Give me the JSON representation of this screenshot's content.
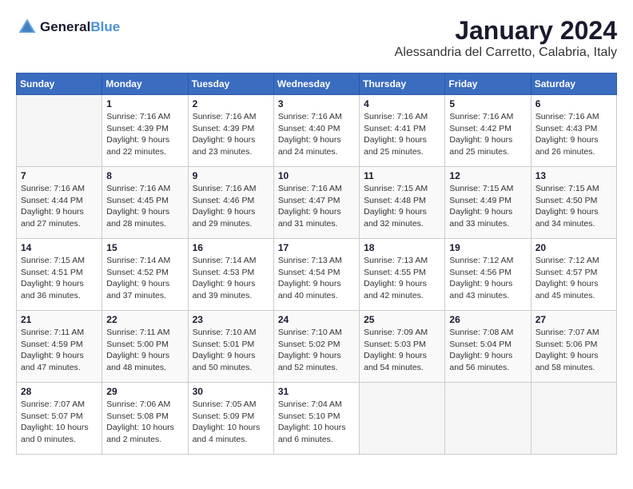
{
  "header": {
    "logo_line1": "General",
    "logo_line2": "Blue",
    "month": "January 2024",
    "location": "Alessandria del Carretto, Calabria, Italy"
  },
  "days_of_week": [
    "Sunday",
    "Monday",
    "Tuesday",
    "Wednesday",
    "Thursday",
    "Friday",
    "Saturday"
  ],
  "weeks": [
    [
      {
        "day": "",
        "info": ""
      },
      {
        "day": "1",
        "info": "Sunrise: 7:16 AM\nSunset: 4:39 PM\nDaylight: 9 hours\nand 22 minutes."
      },
      {
        "day": "2",
        "info": "Sunrise: 7:16 AM\nSunset: 4:39 PM\nDaylight: 9 hours\nand 23 minutes."
      },
      {
        "day": "3",
        "info": "Sunrise: 7:16 AM\nSunset: 4:40 PM\nDaylight: 9 hours\nand 24 minutes."
      },
      {
        "day": "4",
        "info": "Sunrise: 7:16 AM\nSunset: 4:41 PM\nDaylight: 9 hours\nand 25 minutes."
      },
      {
        "day": "5",
        "info": "Sunrise: 7:16 AM\nSunset: 4:42 PM\nDaylight: 9 hours\nand 25 minutes."
      },
      {
        "day": "6",
        "info": "Sunrise: 7:16 AM\nSunset: 4:43 PM\nDaylight: 9 hours\nand 26 minutes."
      }
    ],
    [
      {
        "day": "7",
        "info": "Sunrise: 7:16 AM\nSunset: 4:44 PM\nDaylight: 9 hours\nand 27 minutes."
      },
      {
        "day": "8",
        "info": "Sunrise: 7:16 AM\nSunset: 4:45 PM\nDaylight: 9 hours\nand 28 minutes."
      },
      {
        "day": "9",
        "info": "Sunrise: 7:16 AM\nSunset: 4:46 PM\nDaylight: 9 hours\nand 29 minutes."
      },
      {
        "day": "10",
        "info": "Sunrise: 7:16 AM\nSunset: 4:47 PM\nDaylight: 9 hours\nand 31 minutes."
      },
      {
        "day": "11",
        "info": "Sunrise: 7:15 AM\nSunset: 4:48 PM\nDaylight: 9 hours\nand 32 minutes."
      },
      {
        "day": "12",
        "info": "Sunrise: 7:15 AM\nSunset: 4:49 PM\nDaylight: 9 hours\nand 33 minutes."
      },
      {
        "day": "13",
        "info": "Sunrise: 7:15 AM\nSunset: 4:50 PM\nDaylight: 9 hours\nand 34 minutes."
      }
    ],
    [
      {
        "day": "14",
        "info": "Sunrise: 7:15 AM\nSunset: 4:51 PM\nDaylight: 9 hours\nand 36 minutes."
      },
      {
        "day": "15",
        "info": "Sunrise: 7:14 AM\nSunset: 4:52 PM\nDaylight: 9 hours\nand 37 minutes."
      },
      {
        "day": "16",
        "info": "Sunrise: 7:14 AM\nSunset: 4:53 PM\nDaylight: 9 hours\nand 39 minutes."
      },
      {
        "day": "17",
        "info": "Sunrise: 7:13 AM\nSunset: 4:54 PM\nDaylight: 9 hours\nand 40 minutes."
      },
      {
        "day": "18",
        "info": "Sunrise: 7:13 AM\nSunset: 4:55 PM\nDaylight: 9 hours\nand 42 minutes."
      },
      {
        "day": "19",
        "info": "Sunrise: 7:12 AM\nSunset: 4:56 PM\nDaylight: 9 hours\nand 43 minutes."
      },
      {
        "day": "20",
        "info": "Sunrise: 7:12 AM\nSunset: 4:57 PM\nDaylight: 9 hours\nand 45 minutes."
      }
    ],
    [
      {
        "day": "21",
        "info": "Sunrise: 7:11 AM\nSunset: 4:59 PM\nDaylight: 9 hours\nand 47 minutes."
      },
      {
        "day": "22",
        "info": "Sunrise: 7:11 AM\nSunset: 5:00 PM\nDaylight: 9 hours\nand 48 minutes."
      },
      {
        "day": "23",
        "info": "Sunrise: 7:10 AM\nSunset: 5:01 PM\nDaylight: 9 hours\nand 50 minutes."
      },
      {
        "day": "24",
        "info": "Sunrise: 7:10 AM\nSunset: 5:02 PM\nDaylight: 9 hours\nand 52 minutes."
      },
      {
        "day": "25",
        "info": "Sunrise: 7:09 AM\nSunset: 5:03 PM\nDaylight: 9 hours\nand 54 minutes."
      },
      {
        "day": "26",
        "info": "Sunrise: 7:08 AM\nSunset: 5:04 PM\nDaylight: 9 hours\nand 56 minutes."
      },
      {
        "day": "27",
        "info": "Sunrise: 7:07 AM\nSunset: 5:06 PM\nDaylight: 9 hours\nand 58 minutes."
      }
    ],
    [
      {
        "day": "28",
        "info": "Sunrise: 7:07 AM\nSunset: 5:07 PM\nDaylight: 10 hours\nand 0 minutes."
      },
      {
        "day": "29",
        "info": "Sunrise: 7:06 AM\nSunset: 5:08 PM\nDaylight: 10 hours\nand 2 minutes."
      },
      {
        "day": "30",
        "info": "Sunrise: 7:05 AM\nSunset: 5:09 PM\nDaylight: 10 hours\nand 4 minutes."
      },
      {
        "day": "31",
        "info": "Sunrise: 7:04 AM\nSunset: 5:10 PM\nDaylight: 10 hours\nand 6 minutes."
      },
      {
        "day": "",
        "info": ""
      },
      {
        "day": "",
        "info": ""
      },
      {
        "day": "",
        "info": ""
      }
    ]
  ]
}
